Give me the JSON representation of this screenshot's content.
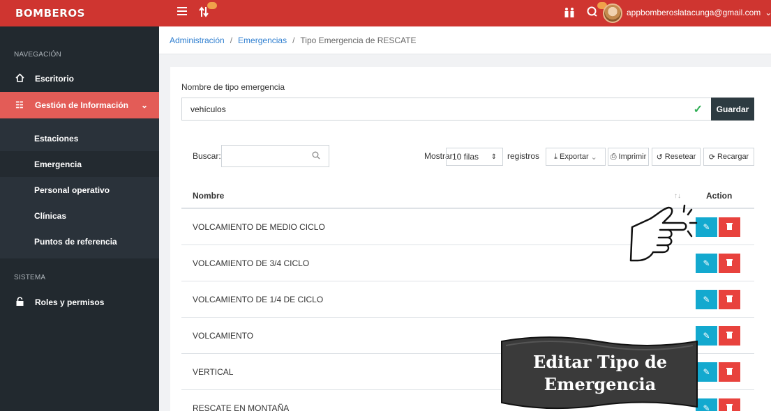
{
  "app": {
    "brand": "BOMBEROS",
    "user_email": "appbomberoslatacunga@gmail.com"
  },
  "topbar_icons": [
    "menu-icon",
    "swap-icon",
    "people-icon",
    "chat-icon"
  ],
  "sidebar": {
    "nav_header": "NAVEGACIÓN",
    "home": "Escritorio",
    "info": "Gestión de Información",
    "subitems": [
      "Estaciones",
      "Emergencia",
      "Personal operativo",
      "Clínicas",
      "Puntos de referencia"
    ],
    "system_header": "SISTEMA",
    "roles": "Roles y permisos"
  },
  "breadcrumb": {
    "b1": "Administración",
    "b2": "Emergencias",
    "b3": "Tipo Emergencia de RESCATE",
    "sep": "/"
  },
  "form": {
    "label": "Nombre de tipo emergencia",
    "value": "vehículos",
    "save": "Guardar"
  },
  "toolbar": {
    "search_label": "Buscar:",
    "show_label": "Mostrar",
    "rows_value": "10 filas",
    "records_label": "registros",
    "export": "Exportar",
    "print": "Imprimir",
    "reset": "Resetear",
    "reload": "Recargar"
  },
  "table": {
    "col_name": "Nombre",
    "col_action": "Action",
    "rows": [
      "VOLCAMIENTO DE MEDIO CICLO",
      "VOLCAMIENTO DE 3/4 CICLO",
      "VOLCAMIENTO DE 1/4 DE CICLO",
      "VOLCAMIENTO",
      "VERTICAL",
      "RESCATE EN MONTAÑA"
    ]
  },
  "overlay": {
    "line1": "Editar Tipo de",
    "line2": "Emergencia"
  },
  "colors": {
    "topbar": "#cf3530",
    "sidebar": "#22292f",
    "active": "#e35c57",
    "edit": "#13a9cf",
    "delete": "#e8423d"
  }
}
